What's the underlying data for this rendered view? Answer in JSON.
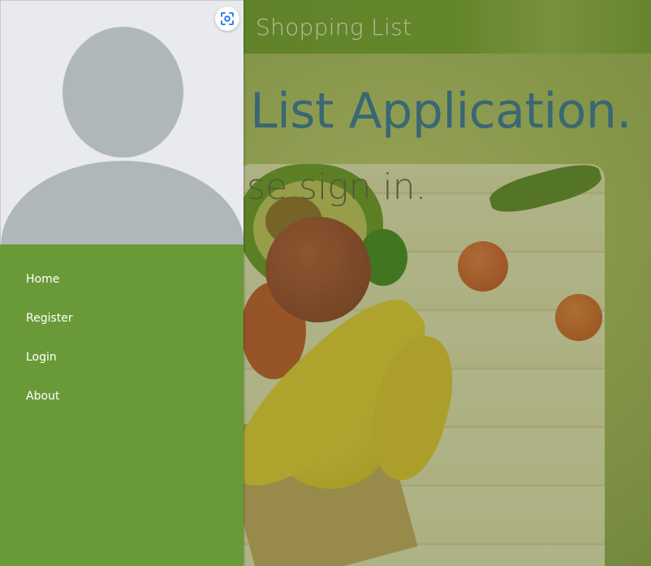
{
  "appbar": {
    "title": "Shopping List"
  },
  "hero": {
    "title": "g List Application.",
    "subtitle": "ease sign in."
  },
  "drawer": {
    "header_icon": "avatar-placeholder",
    "lens_button_icon": "lens-scan-icon",
    "nav_items": [
      {
        "label": "Home"
      },
      {
        "label": "Register"
      },
      {
        "label": "Login"
      },
      {
        "label": "About"
      }
    ]
  },
  "colors": {
    "appbar": "#6b9a35",
    "drawer": "#6a9a38",
    "drawer_header": "#e8eaed",
    "avatar": "#b0b7ba",
    "hero_title": "#1f62b8"
  }
}
